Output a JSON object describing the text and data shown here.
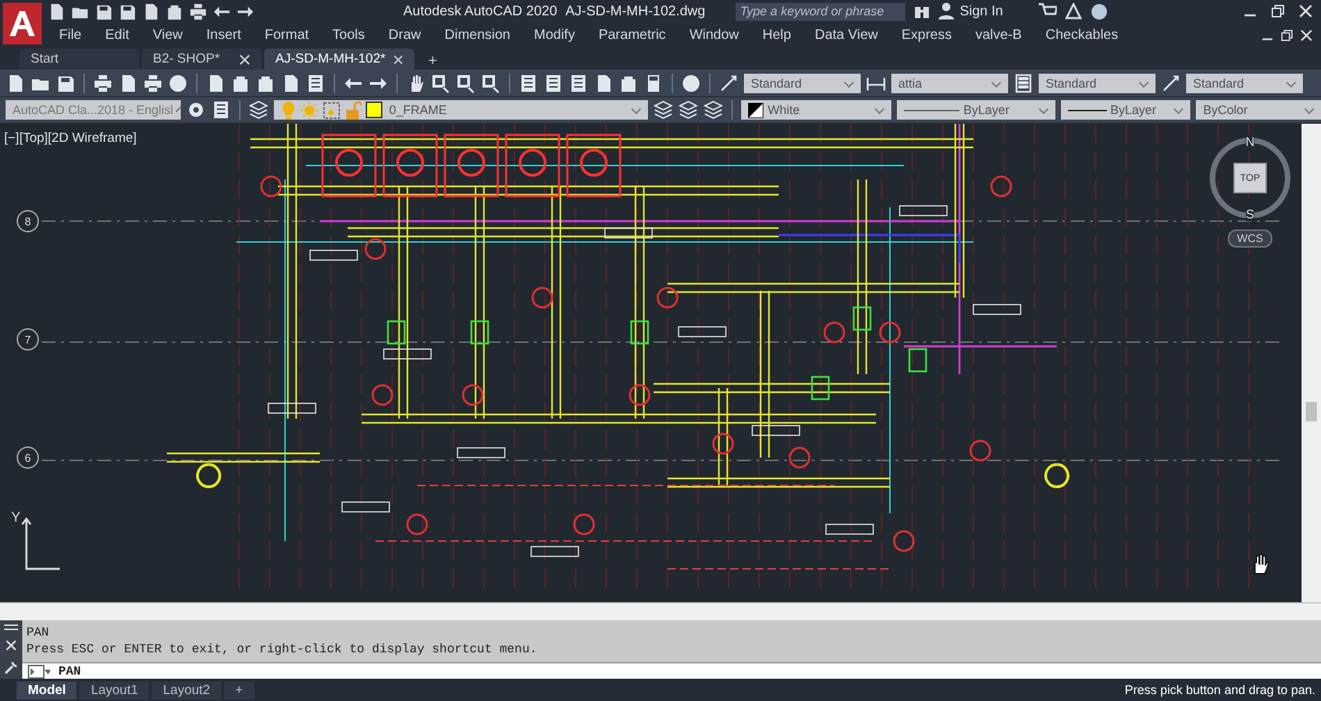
{
  "title_bar": {
    "app": "Autodesk AutoCAD 2020",
    "file": "AJ-SD-M-MH-102.dwg",
    "search_placeholder": "Type a keyword or phrase",
    "sign_in": "Sign In"
  },
  "menu": [
    "File",
    "Edit",
    "View",
    "Insert",
    "Format",
    "Tools",
    "Draw",
    "Dimension",
    "Modify",
    "Parametric",
    "Window",
    "Help",
    "Data View",
    "Express",
    "valve-B",
    "Checkables"
  ],
  "doc_tabs": [
    {
      "label": "Start",
      "selected": false,
      "closable": false
    },
    {
      "label": "B2- SHOP*",
      "selected": false,
      "closable": true
    },
    {
      "label": "AJ-SD-M-MH-102*",
      "selected": true,
      "closable": true
    }
  ],
  "new_tab": "+",
  "toolbar": {
    "style_dropdowns": [
      {
        "kind": "text",
        "value": "Standard"
      },
      {
        "kind": "dim",
        "value": "attia"
      },
      {
        "kind": "table",
        "value": "Standard"
      },
      {
        "kind": "mleader",
        "value": "Standard"
      }
    ],
    "workspace": "AutoCAD Cla...2018 - Englisl",
    "layer": "0_FRAME",
    "properties": [
      {
        "kind": "color",
        "value": "White"
      },
      {
        "kind": "linetype",
        "value": "ByLayer"
      },
      {
        "kind": "lineweight",
        "value": "ByLayer"
      },
      {
        "kind": "plotstyle",
        "value": "ByColor"
      }
    ]
  },
  "viewport": {
    "label": "[−][Top][2D Wireframe]",
    "grid_labels": [
      "8",
      "7",
      "6"
    ],
    "viewcube": {
      "north": "N",
      "south": "S",
      "face": "TOP",
      "ucs": "WCS"
    },
    "ucs_axis": "Y"
  },
  "command": {
    "history": [
      "PAN",
      "Press ESC or ENTER to exit, or right-click to display shortcut menu."
    ],
    "input": "PAN"
  },
  "layout_tabs": [
    {
      "label": "Model",
      "selected": true
    },
    {
      "label": "Layout1",
      "selected": false
    },
    {
      "label": "Layout2",
      "selected": false
    }
  ],
  "new_layout": "+",
  "status": "Press pick button and drag to pan."
}
